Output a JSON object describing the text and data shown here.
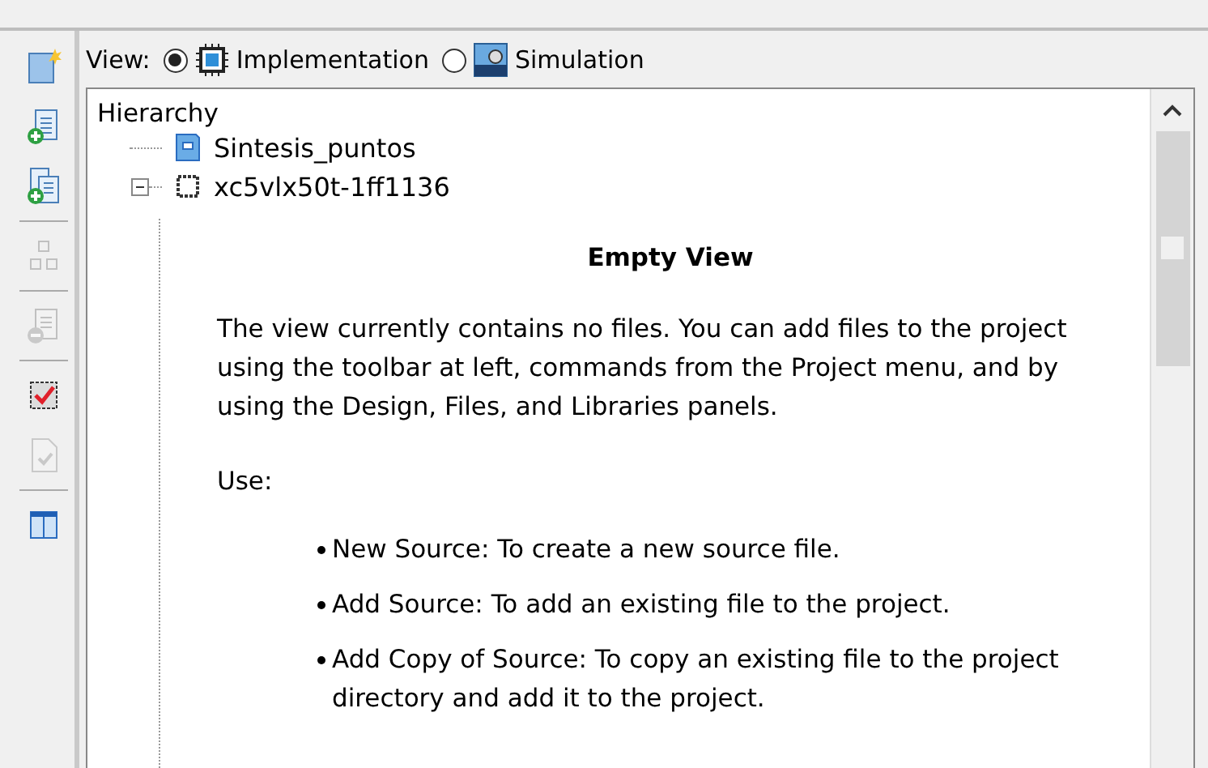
{
  "toolbar": [
    {
      "kind": "new-file",
      "disabled": false
    },
    {
      "kind": "add-file",
      "disabled": false
    },
    {
      "kind": "add-copy",
      "disabled": false
    },
    {
      "kind": "separator"
    },
    {
      "kind": "chip-grid",
      "disabled": true
    },
    {
      "kind": "separator"
    },
    {
      "kind": "remove-file",
      "disabled": true
    },
    {
      "kind": "separator"
    },
    {
      "kind": "chip-check",
      "disabled": false
    },
    {
      "kind": "doc-check",
      "disabled": true
    },
    {
      "kind": "separator"
    },
    {
      "kind": "columns",
      "disabled": false
    }
  ],
  "view": {
    "label": "View:",
    "options": [
      {
        "label": "Implementation",
        "kind": "implementation",
        "selected": true
      },
      {
        "label": "Simulation",
        "kind": "simulation",
        "selected": false
      }
    ]
  },
  "hierarchy": {
    "title": "Hierarchy",
    "items": [
      {
        "label": "Sintesis_puntos",
        "kind": "project"
      },
      {
        "label": "xc5vlx50t-1ff1136",
        "kind": "device",
        "expanded": true
      }
    ]
  },
  "empty_view": {
    "title": "Empty View",
    "intro": "The view currently contains no files. You can add files to the project using the toolbar at left, commands from the Project menu, and by using the Design, Files, and Libraries panels.",
    "use_label": "Use:",
    "bullets": [
      "New Source: To create a new source file.",
      "Add Source: To add an existing file to the project.",
      "Add Copy of Source: To copy an existing file to the project directory and add it to the project."
    ]
  }
}
